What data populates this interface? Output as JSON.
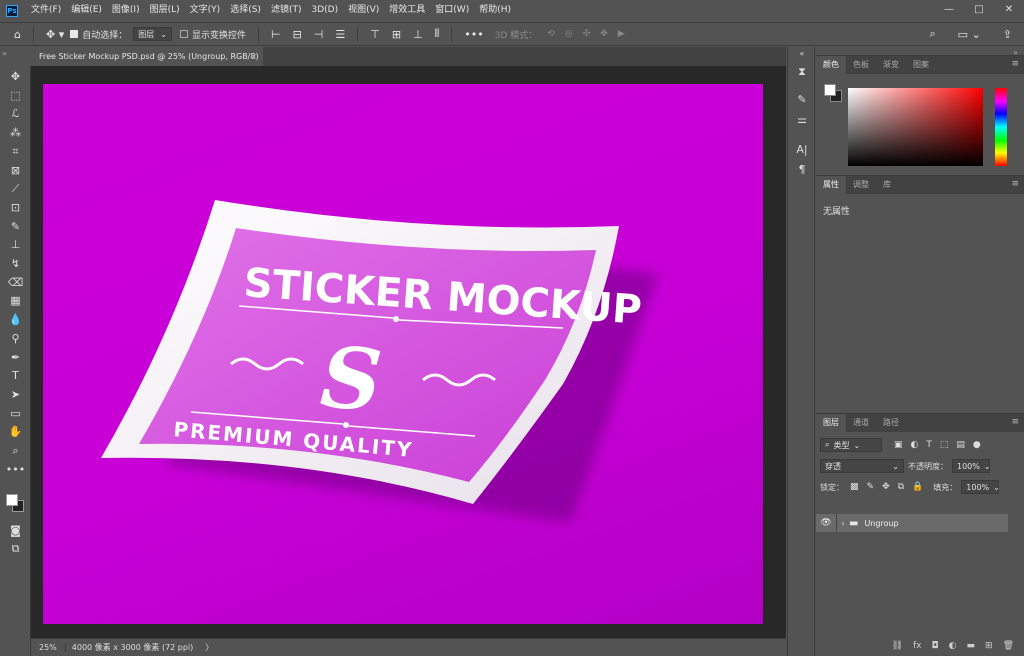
{
  "menubar": {
    "logo": "Ps",
    "items": [
      "文件(F)",
      "编辑(E)",
      "图像(I)",
      "图层(L)",
      "文字(Y)",
      "选择(S)",
      "滤镜(T)",
      "3D(D)",
      "视图(V)",
      "增效工具",
      "窗口(W)",
      "帮助(H)"
    ],
    "window_controls": [
      "—",
      "□",
      "✕"
    ]
  },
  "options_bar": {
    "auto_select_label": "自动选择：",
    "auto_select_checked": true,
    "auto_select_target": "图层",
    "show_transform_label": "显示变换控件",
    "show_transform_checked": false,
    "more_label": "•••",
    "mode_3d_label": "3D 模式："
  },
  "document": {
    "tab_title": "Free Sticker Mockup PSD.psd @ 25% (Ungroup, RGB/8)",
    "tab_close": "×",
    "zoom": "25%",
    "info": "4000 像素 x 3000 像素 (72 ppi)",
    "info_chevron": "〉",
    "background_color": "#cc00d8"
  },
  "artwork": {
    "title": "STICKER MOCKUP",
    "monogram": "S",
    "subtitle": "PREMIUM QUALITY",
    "sticker_fill": "#d94fe0",
    "sticker_border": "#ffffff"
  },
  "toolbar": {
    "grip": "»",
    "tools": [
      {
        "name": "move-tool-icon",
        "glyph": "✥"
      },
      {
        "name": "marquee-tool-icon",
        "glyph": "⬚"
      },
      {
        "name": "lasso-tool-icon",
        "glyph": "ℒ"
      },
      {
        "name": "magic-wand-tool-icon",
        "glyph": "⁂"
      },
      {
        "name": "crop-tool-icon",
        "glyph": "⌗"
      },
      {
        "name": "frame-tool-icon",
        "glyph": "⊠"
      },
      {
        "name": "eyedropper-tool-icon",
        "glyph": "⟋"
      },
      {
        "name": "healing-brush-tool-icon",
        "glyph": "⊡"
      },
      {
        "name": "brush-tool-icon",
        "glyph": "✎"
      },
      {
        "name": "clone-stamp-tool-icon",
        "glyph": "⊥"
      },
      {
        "name": "history-brush-tool-icon",
        "glyph": "↯"
      },
      {
        "name": "eraser-tool-icon",
        "glyph": "⌫"
      },
      {
        "name": "gradient-tool-icon",
        "glyph": "▦"
      },
      {
        "name": "blur-tool-icon",
        "glyph": "💧"
      },
      {
        "name": "dodge-tool-icon",
        "glyph": "⚲"
      },
      {
        "name": "pen-tool-icon",
        "glyph": "✒"
      },
      {
        "name": "type-tool-icon",
        "glyph": "T"
      },
      {
        "name": "path-selection-tool-icon",
        "glyph": "➤"
      },
      {
        "name": "shape-tool-icon",
        "glyph": "▭"
      },
      {
        "name": "hand-tool-icon",
        "glyph": "✋"
      },
      {
        "name": "zoom-tool-icon",
        "glyph": "⌕"
      },
      {
        "name": "edit-toolbar-icon",
        "glyph": "•••"
      }
    ]
  },
  "color_panel": {
    "tabs": [
      "颜色",
      "色板",
      "渐变",
      "图案"
    ],
    "active_tab": "颜色",
    "foreground": "#ffffff",
    "background": "#222222"
  },
  "properties_panel": {
    "tabs": [
      "属性",
      "调整",
      "库"
    ],
    "active_tab": "属性",
    "body_text": "无属性"
  },
  "layers_panel": {
    "tabs": [
      "图层",
      "通道",
      "路径"
    ],
    "active_tab": "图层",
    "filter_kind": "类型",
    "blend_mode": "穿透",
    "opacity_label": "不透明度：",
    "opacity_value": "100%",
    "lock_label": "锁定：",
    "fill_label": "填充：",
    "fill_value": "100%",
    "layers": [
      {
        "name": "Ungroup",
        "type": "group",
        "visible": true
      }
    ],
    "footer_icons": [
      "link-icon",
      "fx-icon",
      "mask-icon",
      "adjustment-icon",
      "folder-icon",
      "new-layer-icon",
      "trash-icon"
    ],
    "footer_glyphs": [
      "⛓",
      "fx",
      "◘",
      "◐",
      "▬",
      "⊞",
      "🗑"
    ]
  }
}
